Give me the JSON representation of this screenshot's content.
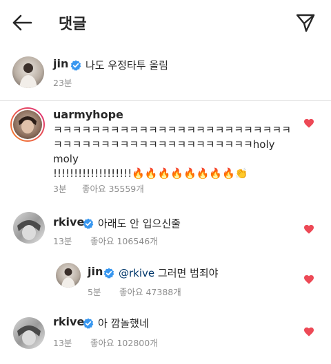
{
  "header": {
    "title": "댓글",
    "back_icon": "arrow-left-icon",
    "send_icon": "paper-plane-icon"
  },
  "colors": {
    "heart": "#ed4956",
    "verified": "#3897f0",
    "story_ring_start": "#f58529",
    "story_ring_end": "#dd2a7b"
  },
  "caption": {
    "username": "jin",
    "verified": true,
    "text": "나도 우정타투 올림",
    "time": "23분"
  },
  "comments": [
    {
      "username": "uarmyhope",
      "verified": false,
      "lines": [
        "ㅋㅋㅋㅋㅋㅋㅋㅋㅋㅋㅋㅋㅋㅋㅋㅋㅋㅋㅋㅋㅋㅋㅋㅋㅋ",
        "ㅋㅋㅋㅋㅋㅋㅋㅋㅋㅋㅋㅋㅋㅋㅋㅋㅋㅋㅋㅋㅋholy",
        "moly",
        "!!!!!!!!!!!!!!!!!!!🔥🔥🔥🔥🔥🔥🔥🔥👏"
      ],
      "time": "3분",
      "likes": "좋아요 35559개"
    },
    {
      "username": "rkive",
      "verified": true,
      "text": "아래도 안 입으신줄",
      "time": "13분",
      "likes": "좋아요 106546개"
    },
    {
      "username": "jin",
      "verified": true,
      "mention": "@rkive",
      "text": " 그러면 범죄야",
      "time": "5분",
      "likes": "좋아요 47388개"
    },
    {
      "username": "rkive",
      "verified": true,
      "text": "아 깜놀했네",
      "time": "13분",
      "likes": "좋아요 102800개"
    }
  ]
}
